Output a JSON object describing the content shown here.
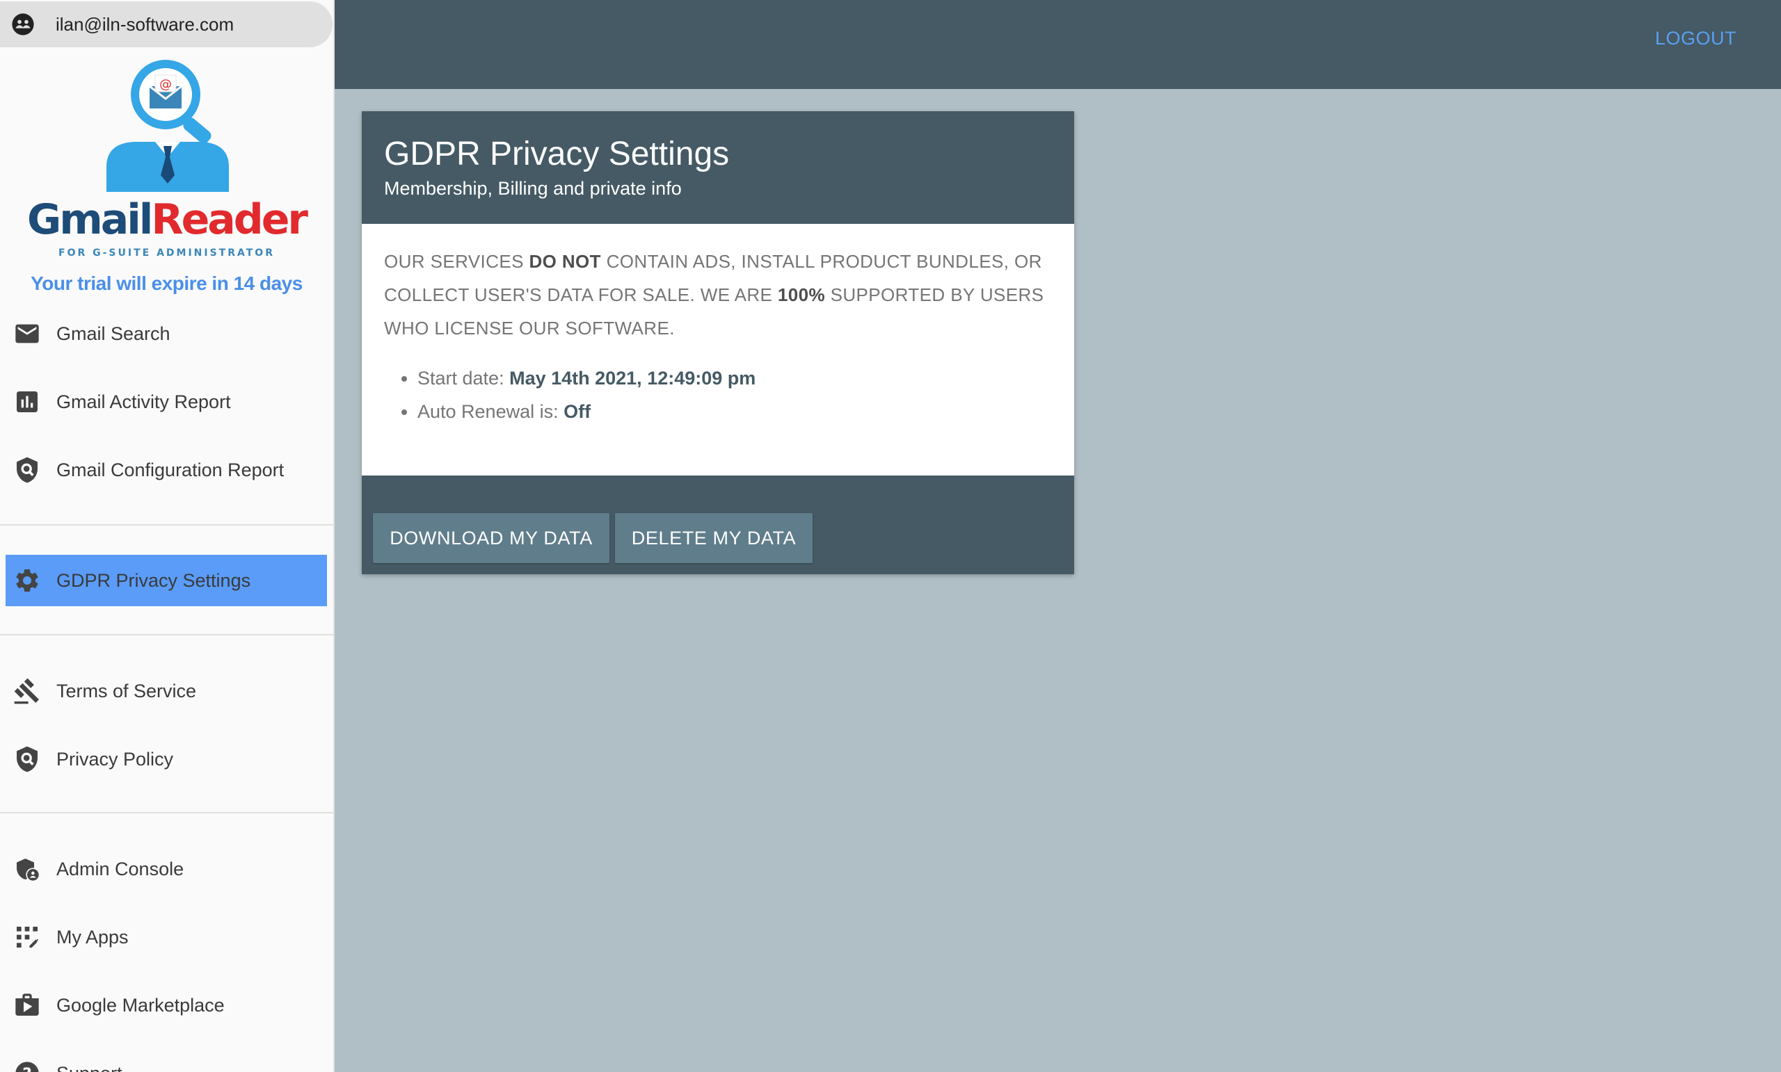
{
  "account": {
    "email": "ilan@iln-software.com"
  },
  "logo": {
    "title_part1": "Gmail",
    "title_part2": "Reader",
    "subtitle": "FOR G-SUITE ADMINISTRATOR"
  },
  "trial_notice": "Your trial will expire in 14 days",
  "sidebar": {
    "items": [
      {
        "label": "Gmail Search",
        "icon": "mail-icon"
      },
      {
        "label": "Gmail Activity Report",
        "icon": "bar-chart-icon"
      },
      {
        "label": "Gmail Configuration Report",
        "icon": "shield-search-icon"
      },
      {
        "label": "GDPR Privacy Settings",
        "icon": "gear-icon",
        "active": true
      },
      {
        "label": "Terms of Service",
        "icon": "gavel-icon"
      },
      {
        "label": "Privacy Policy",
        "icon": "shield-search-icon"
      },
      {
        "label": "Admin Console",
        "icon": "admin-shield-icon"
      },
      {
        "label": "My Apps",
        "icon": "apps-grid-icon"
      },
      {
        "label": "Google Marketplace",
        "icon": "shop-icon"
      },
      {
        "label": "Support",
        "icon": "help-icon"
      }
    ]
  },
  "topbar": {
    "logout_label": "LOGOUT"
  },
  "card": {
    "title": "GDPR Privacy Settings",
    "subtitle": "Membership, Billing and private info",
    "statement": {
      "part1": "Our services ",
      "bold1": "do not",
      "part2": " contain ads, install product bundles, or collect user's data for sale. We are ",
      "bold2": "100%",
      "part3": " supported by users who license our software."
    },
    "details": {
      "start_date_label": "Start date: ",
      "start_date_value": "May 14th 2021, 12:49:09 pm",
      "auto_renewal_label": "Auto Renewal is: ",
      "auto_renewal_value": "Off"
    },
    "download_label": "DOWNLOAD MY DATA",
    "delete_label": "DELETE MY DATA"
  },
  "colors": {
    "topbar": "#455a64",
    "background": "#b0bec5",
    "active_item": "#5a9cf8",
    "button": "#607d8b",
    "link": "#5aa0f2",
    "trial_text": "#4a8fe9"
  }
}
